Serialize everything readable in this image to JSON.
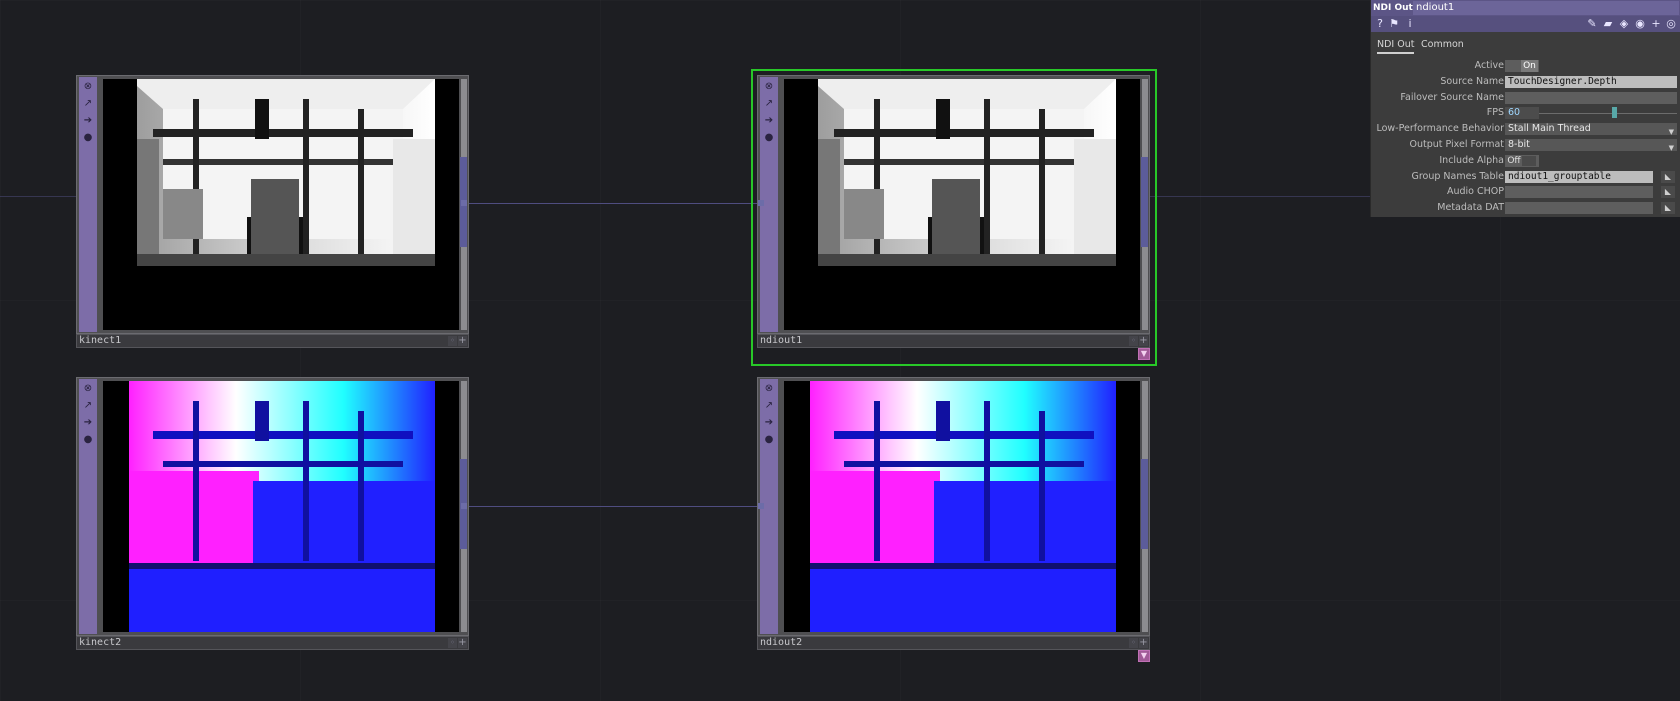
{
  "nodes": {
    "kinect1": {
      "name": "kinect1"
    },
    "ndiout1": {
      "name": "ndiout1"
    },
    "kinect2": {
      "name": "kinect2"
    },
    "ndiout2": {
      "name": "ndiout2"
    }
  },
  "panel": {
    "op_type": "NDI Out",
    "op_name": "ndiout1",
    "tabs": [
      "NDI Out",
      "Common"
    ],
    "active_tab": "NDI Out",
    "params": {
      "active": {
        "label": "Active",
        "value": "On"
      },
      "source_name": {
        "label": "Source Name",
        "value": "TouchDesigner.Depth"
      },
      "failover_source_name": {
        "label": "Failover Source Name",
        "value": ""
      },
      "fps": {
        "label": "FPS",
        "value": "60",
        "slider_fraction": 0.55
      },
      "low_performance_behavior": {
        "label": "Low-Performance Behavior",
        "value": "Stall Main Thread"
      },
      "output_pixel_format": {
        "label": "Output Pixel Format",
        "value": "8-bit"
      },
      "include_alpha": {
        "label": "Include Alpha",
        "value": "Off"
      },
      "group_names_table": {
        "label": "Group Names Table",
        "value": "ndiout1_grouptable"
      },
      "audio_chop": {
        "label": "Audio CHOP",
        "value": ""
      },
      "metadata_dat": {
        "label": "Metadata DAT",
        "value": ""
      }
    },
    "toolbar_icons": [
      "help-icon",
      "python-help-icon",
      "info-icon",
      "edit-icon",
      "comment-icon",
      "bookmark-icon",
      "python-icon",
      "add-icon",
      "target-icon"
    ]
  },
  "colors": {
    "background": "#1d1e22",
    "selection": "#28c828",
    "sidebar": "#7d6da8",
    "wire": "#4f4d80"
  }
}
